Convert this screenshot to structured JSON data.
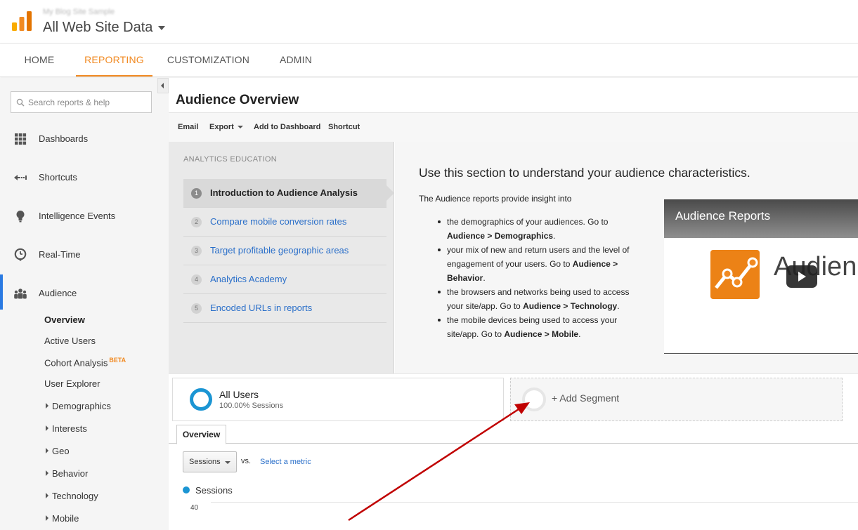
{
  "header": {
    "account_name": "My Blog Site Sample",
    "property_title": "All Web Site Data"
  },
  "nav": {
    "tabs": [
      {
        "label": "HOME"
      },
      {
        "label": "REPORTING",
        "active": true
      },
      {
        "label": "CUSTOMIZATION"
      },
      {
        "label": "ADMIN"
      }
    ]
  },
  "sidebar": {
    "search_placeholder": "Search reports & help",
    "items": [
      {
        "label": "Dashboards",
        "icon": "grid-icon"
      },
      {
        "label": "Shortcuts",
        "icon": "arrow-left-icon"
      },
      {
        "label": "Intelligence Events",
        "icon": "lightbulb-icon"
      },
      {
        "label": "Real-Time",
        "icon": "clock-icon"
      },
      {
        "label": "Audience",
        "icon": "people-icon"
      }
    ],
    "audience_sub": [
      "Overview",
      "Active Users",
      "Cohort Analysis",
      "User Explorer",
      "Demographics",
      "Interests",
      "Geo",
      "Behavior",
      "Technology",
      "Mobile"
    ],
    "beta_badge": "BETA"
  },
  "main": {
    "page_title": "Audience Overview",
    "toolbar": {
      "email": "Email",
      "export": "Export",
      "add_dashboard": "Add to Dashboard",
      "shortcut": "Shortcut"
    },
    "education": {
      "heading": "ANALYTICS EDUCATION",
      "steps": [
        {
          "num": "1",
          "label": "Introduction to Audience Analysis"
        },
        {
          "num": "2",
          "label": "Compare mobile conversion rates"
        },
        {
          "num": "3",
          "label": "Target profitable geographic areas"
        },
        {
          "num": "4",
          "label": "Analytics Academy"
        },
        {
          "num": "5",
          "label": "Encoded URLs in reports"
        }
      ],
      "title": "Use this section to understand your audience characteristics.",
      "intro": "The Audience reports provide insight into",
      "bullets": [
        {
          "text": "the demographics of your audiences. Go to ",
          "bold": "Audience > Demographics",
          "end": "."
        },
        {
          "text": "your mix of new and return users and the level of engagement of your users. Go to ",
          "bold": "Audience > Behavior",
          "end": "."
        },
        {
          "text": "the browsers and networks being used to access your site/app. Go to ",
          "bold": "Audience > Technology",
          "end": "."
        },
        {
          "text": "the mobile devices being used to access your site/app. Go to ",
          "bold": "Audience > Mobile",
          "end": "."
        }
      ],
      "video_title": "Audience Reports",
      "video_word": "Audience"
    },
    "segments": {
      "all_users_name": "All Users",
      "all_users_sub": "100.00% Sessions",
      "add_segment": "+ Add Segment"
    },
    "overview_tab": "Overview",
    "metric_select": "Sessions",
    "vs": "vs.",
    "select_metric": "Select a metric",
    "legend_label": "Sessions",
    "y_tick": "40"
  },
  "colors": {
    "accent": "#f18a22",
    "link": "#2a6fc9",
    "series": "#1b95d3",
    "annotation": "#c00000"
  }
}
